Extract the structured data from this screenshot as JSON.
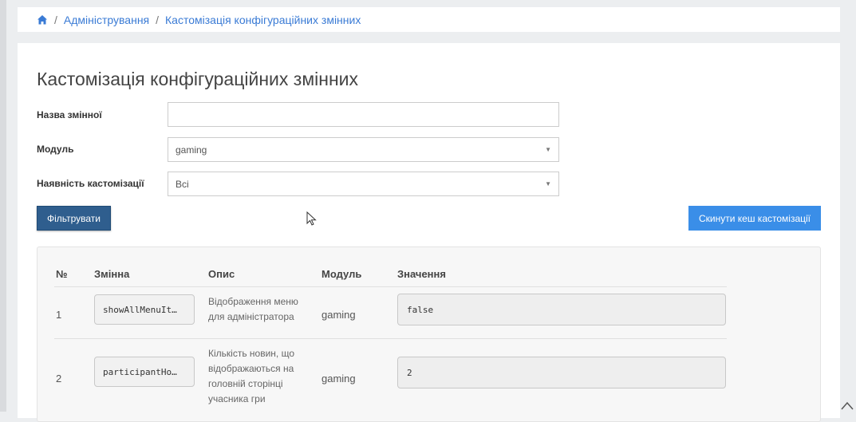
{
  "breadcrumb": {
    "home_icon": "home-icon",
    "separator": "/",
    "items": [
      "Адміністрування",
      "Кастомізація конфігураційних змінних"
    ]
  },
  "page": {
    "title": "Кастомізація конфігураційних змінних"
  },
  "form": {
    "variable_name": {
      "label": "Назва змінної",
      "value": ""
    },
    "module": {
      "label": "Модуль",
      "selected": "gaming"
    },
    "customization": {
      "label": "Наявність кастомізації",
      "selected": "Всі"
    }
  },
  "buttons": {
    "filter": "Фільтрувати",
    "reset_cache": "Скинути кеш кастомізації"
  },
  "table": {
    "headers": [
      "№",
      "Змінна",
      "Опис",
      "Модуль",
      "Значення"
    ],
    "rows": [
      {
        "num": "1",
        "variable": "showAllMenuIt…",
        "description": "Відображення меню для адміністратора",
        "module": "gaming",
        "value": "false"
      },
      {
        "num": "2",
        "variable": "participantHo…",
        "description": "Кількість новин, що відображаються на головній сторінці учасника гри",
        "module": "gaming",
        "value": "2"
      }
    ]
  },
  "colors": {
    "link": "#3a7bd5",
    "filter_button": "#2f5e8e",
    "reset_button": "#3a8ee8"
  }
}
